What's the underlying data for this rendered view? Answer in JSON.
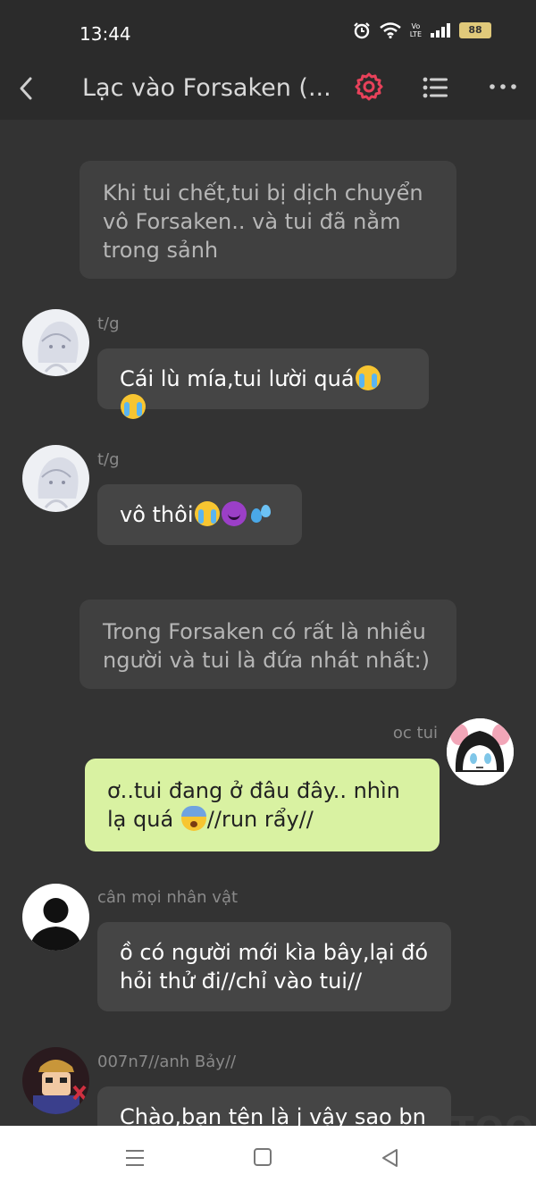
{
  "status_bar": {
    "time": "13:44",
    "battery": "88",
    "network": "Vo LTE",
    "icons": [
      "alarm-icon",
      "wifi-icon",
      "volte-icon",
      "signal-icon",
      "battery-icon"
    ]
  },
  "header": {
    "title": "Lạc vào Forsaken (...",
    "icons": [
      "back-icon",
      "gear-icon",
      "list-icon",
      "more-icon"
    ],
    "accent": "#e8415a"
  },
  "messages": [
    {
      "type": "narration",
      "text": "Khi tui chết,tui bị dịch chuyển vô Forsaken.. và tui đã nằm trong sảnh"
    },
    {
      "type": "character",
      "name": "t/g",
      "text": "Cái lù mía,tui lười quá",
      "emojis": [
        "loudly-crying-face",
        "loudly-crying-face"
      ]
    },
    {
      "type": "character",
      "name": "t/g",
      "text": "vô thôi",
      "emojis": [
        "loudly-crying-face",
        "smiling-face-with-horns",
        "sweat-droplets"
      ]
    },
    {
      "type": "narration",
      "text": "Trong Forsaken có rất là nhiều người và tui là đứa nhát nhất:)"
    },
    {
      "type": "self",
      "name": "oc tui",
      "text_before": "ơ..tui đang ở đâu đây.. nhìn lạ quá ",
      "emoji": "fearful-face",
      "text_after": "//run rẩy//"
    },
    {
      "type": "character",
      "name": "cân mọi nhân vật",
      "text": "ồ có người mới kìa bây,lại đó hỏi thử đi//chỉ vào tui//"
    },
    {
      "type": "character",
      "name": "007n7//anh Bảy//",
      "text": "Chào,bạn tên là j vậy sao bn"
    }
  ],
  "watermark": "MANGATOON",
  "colors": {
    "background": "#333333",
    "self_bubble": "#d9f2a2",
    "bubble": "#454545",
    "narration_bubble": "#404040"
  },
  "nav_bar": {
    "icons": [
      "menu-icon",
      "home-icon",
      "back-triangle-icon"
    ]
  }
}
